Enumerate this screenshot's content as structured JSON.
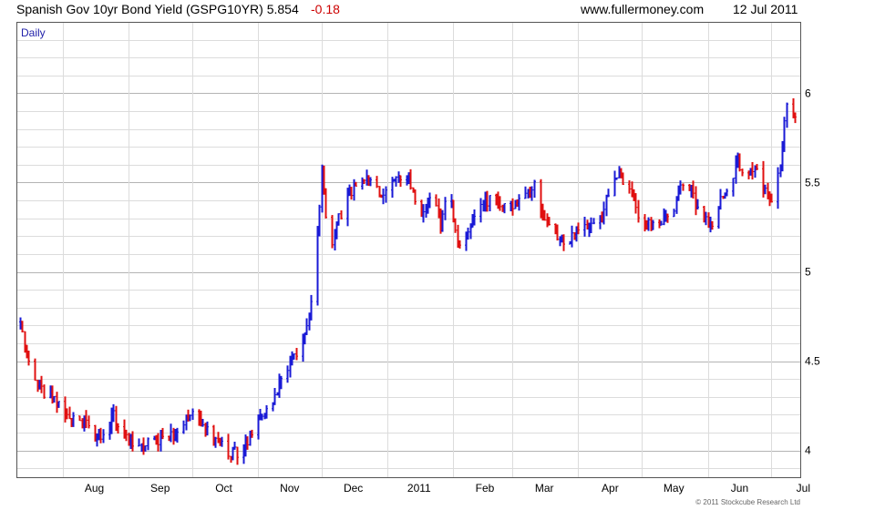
{
  "header": {
    "title": "Spanish Gov 10yr Bond Yield (GSPG10YR) 5.854",
    "change": "-0.18",
    "site": "www.fullermoney.com",
    "date": "12 Jul 2011"
  },
  "colors": {
    "up": "#1a1ad6",
    "down": "#e01010",
    "change": "#cc0000"
  },
  "chart_data": {
    "type": "ohlc",
    "period_label": "Daily",
    "copyright": "© 2011 Stockcube Research Ltd",
    "grid": true,
    "ylim": [
      3.85,
      6.4
    ],
    "y_ticks": [
      4,
      4.5,
      5,
      5.5,
      6
    ],
    "y_tick_labels": [
      "4",
      "4.5",
      "5",
      "5.5",
      "6"
    ],
    "x_labels": [
      "Aug",
      "Sep",
      "Oct",
      "Nov",
      "Dec",
      "2011",
      "Feb",
      "Mar",
      "Apr",
      "May",
      "Jun",
      "Jul"
    ],
    "x_label_dates": [
      "2010-08-01",
      "2010-09-01",
      "2010-10-01",
      "2010-11-01",
      "2010-12-01",
      "2011-01-01",
      "2011-02-01",
      "2011-03-01",
      "2011-04-01",
      "2011-05-01",
      "2011-06-01",
      "2011-07-01"
    ],
    "x_start": "2010-07-12",
    "x_end": "2011-07-12",
    "close_series": [
      [
        "2010-07-12",
        4.72
      ],
      [
        "2010-07-16",
        4.5
      ],
      [
        "2010-07-20",
        4.38
      ],
      [
        "2010-07-24",
        4.3
      ],
      [
        "2010-07-28",
        4.3
      ],
      [
        "2010-08-01",
        4.22
      ],
      [
        "2010-08-05",
        4.18
      ],
      [
        "2010-08-09",
        4.2
      ],
      [
        "2010-08-13",
        4.12
      ],
      [
        "2010-08-17",
        4.06
      ],
      [
        "2010-08-21",
        4.1
      ],
      [
        "2010-08-25",
        4.2
      ],
      [
        "2010-08-29",
        4.08
      ],
      [
        "2010-09-02",
        4.05
      ],
      [
        "2010-09-06",
        4.02
      ],
      [
        "2010-09-10",
        4.06
      ],
      [
        "2010-09-14",
        4.04
      ],
      [
        "2010-09-18",
        4.06
      ],
      [
        "2010-09-22",
        4.08
      ],
      [
        "2010-09-26",
        4.15
      ],
      [
        "2010-09-30",
        4.2
      ],
      [
        "2010-10-04",
        4.18
      ],
      [
        "2010-10-08",
        4.1
      ],
      [
        "2010-10-12",
        4.05
      ],
      [
        "2010-10-16",
        4.02
      ],
      [
        "2010-10-20",
        3.98
      ],
      [
        "2010-10-24",
        4.0
      ],
      [
        "2010-10-28",
        4.08
      ],
      [
        "2010-11-01",
        4.15
      ],
      [
        "2010-11-05",
        4.22
      ],
      [
        "2010-11-09",
        4.3
      ],
      [
        "2010-11-13",
        4.42
      ],
      [
        "2010-11-17",
        4.52
      ],
      [
        "2010-11-21",
        4.58
      ],
      [
        "2010-11-25",
        4.75
      ],
      [
        "2010-11-29",
        5.2
      ],
      [
        "2010-12-01",
        5.55
      ],
      [
        "2010-12-05",
        5.1
      ],
      [
        "2010-12-09",
        5.3
      ],
      [
        "2010-12-13",
        5.42
      ],
      [
        "2010-12-17",
        5.5
      ],
      [
        "2010-12-21",
        5.52
      ],
      [
        "2010-12-25",
        5.5
      ],
      [
        "2010-12-29",
        5.45
      ],
      [
        "2011-01-02",
        5.48
      ],
      [
        "2011-01-06",
        5.52
      ],
      [
        "2011-01-10",
        5.55
      ],
      [
        "2011-01-14",
        5.4
      ],
      [
        "2011-01-18",
        5.32
      ],
      [
        "2011-01-22",
        5.45
      ],
      [
        "2011-01-26",
        5.25
      ],
      [
        "2011-01-30",
        5.48
      ],
      [
        "2011-02-03",
        5.15
      ],
      [
        "2011-02-07",
        5.2
      ],
      [
        "2011-02-11",
        5.3
      ],
      [
        "2011-02-15",
        5.38
      ],
      [
        "2011-02-19",
        5.42
      ],
      [
        "2011-02-23",
        5.38
      ],
      [
        "2011-02-27",
        5.35
      ],
      [
        "2011-03-03",
        5.38
      ],
      [
        "2011-03-07",
        5.42
      ],
      [
        "2011-03-11",
        5.5
      ],
      [
        "2011-03-15",
        5.32
      ],
      [
        "2011-03-19",
        5.22
      ],
      [
        "2011-03-23",
        5.18
      ],
      [
        "2011-03-27",
        5.17
      ],
      [
        "2011-03-31",
        5.22
      ],
      [
        "2011-04-04",
        5.28
      ],
      [
        "2011-04-08",
        5.25
      ],
      [
        "2011-04-12",
        5.3
      ],
      [
        "2011-04-16",
        5.48
      ],
      [
        "2011-04-20",
        5.55
      ],
      [
        "2011-04-24",
        5.5
      ],
      [
        "2011-04-28",
        5.35
      ],
      [
        "2011-05-02",
        5.28
      ],
      [
        "2011-05-06",
        5.25
      ],
      [
        "2011-05-10",
        5.28
      ],
      [
        "2011-05-14",
        5.3
      ],
      [
        "2011-05-18",
        5.45
      ],
      [
        "2011-05-22",
        5.52
      ],
      [
        "2011-05-26",
        5.38
      ],
      [
        "2011-05-30",
        5.3
      ],
      [
        "2011-06-03",
        5.25
      ],
      [
        "2011-06-07",
        5.4
      ],
      [
        "2011-06-11",
        5.5
      ],
      [
        "2011-06-15",
        5.62
      ],
      [
        "2011-06-19",
        5.55
      ],
      [
        "2011-06-23",
        5.6
      ],
      [
        "2011-06-27",
        5.48
      ],
      [
        "2011-07-01",
        5.4
      ],
      [
        "2011-07-05",
        5.6
      ],
      [
        "2011-07-08",
        5.95
      ],
      [
        "2011-07-12",
        5.854
      ]
    ]
  }
}
